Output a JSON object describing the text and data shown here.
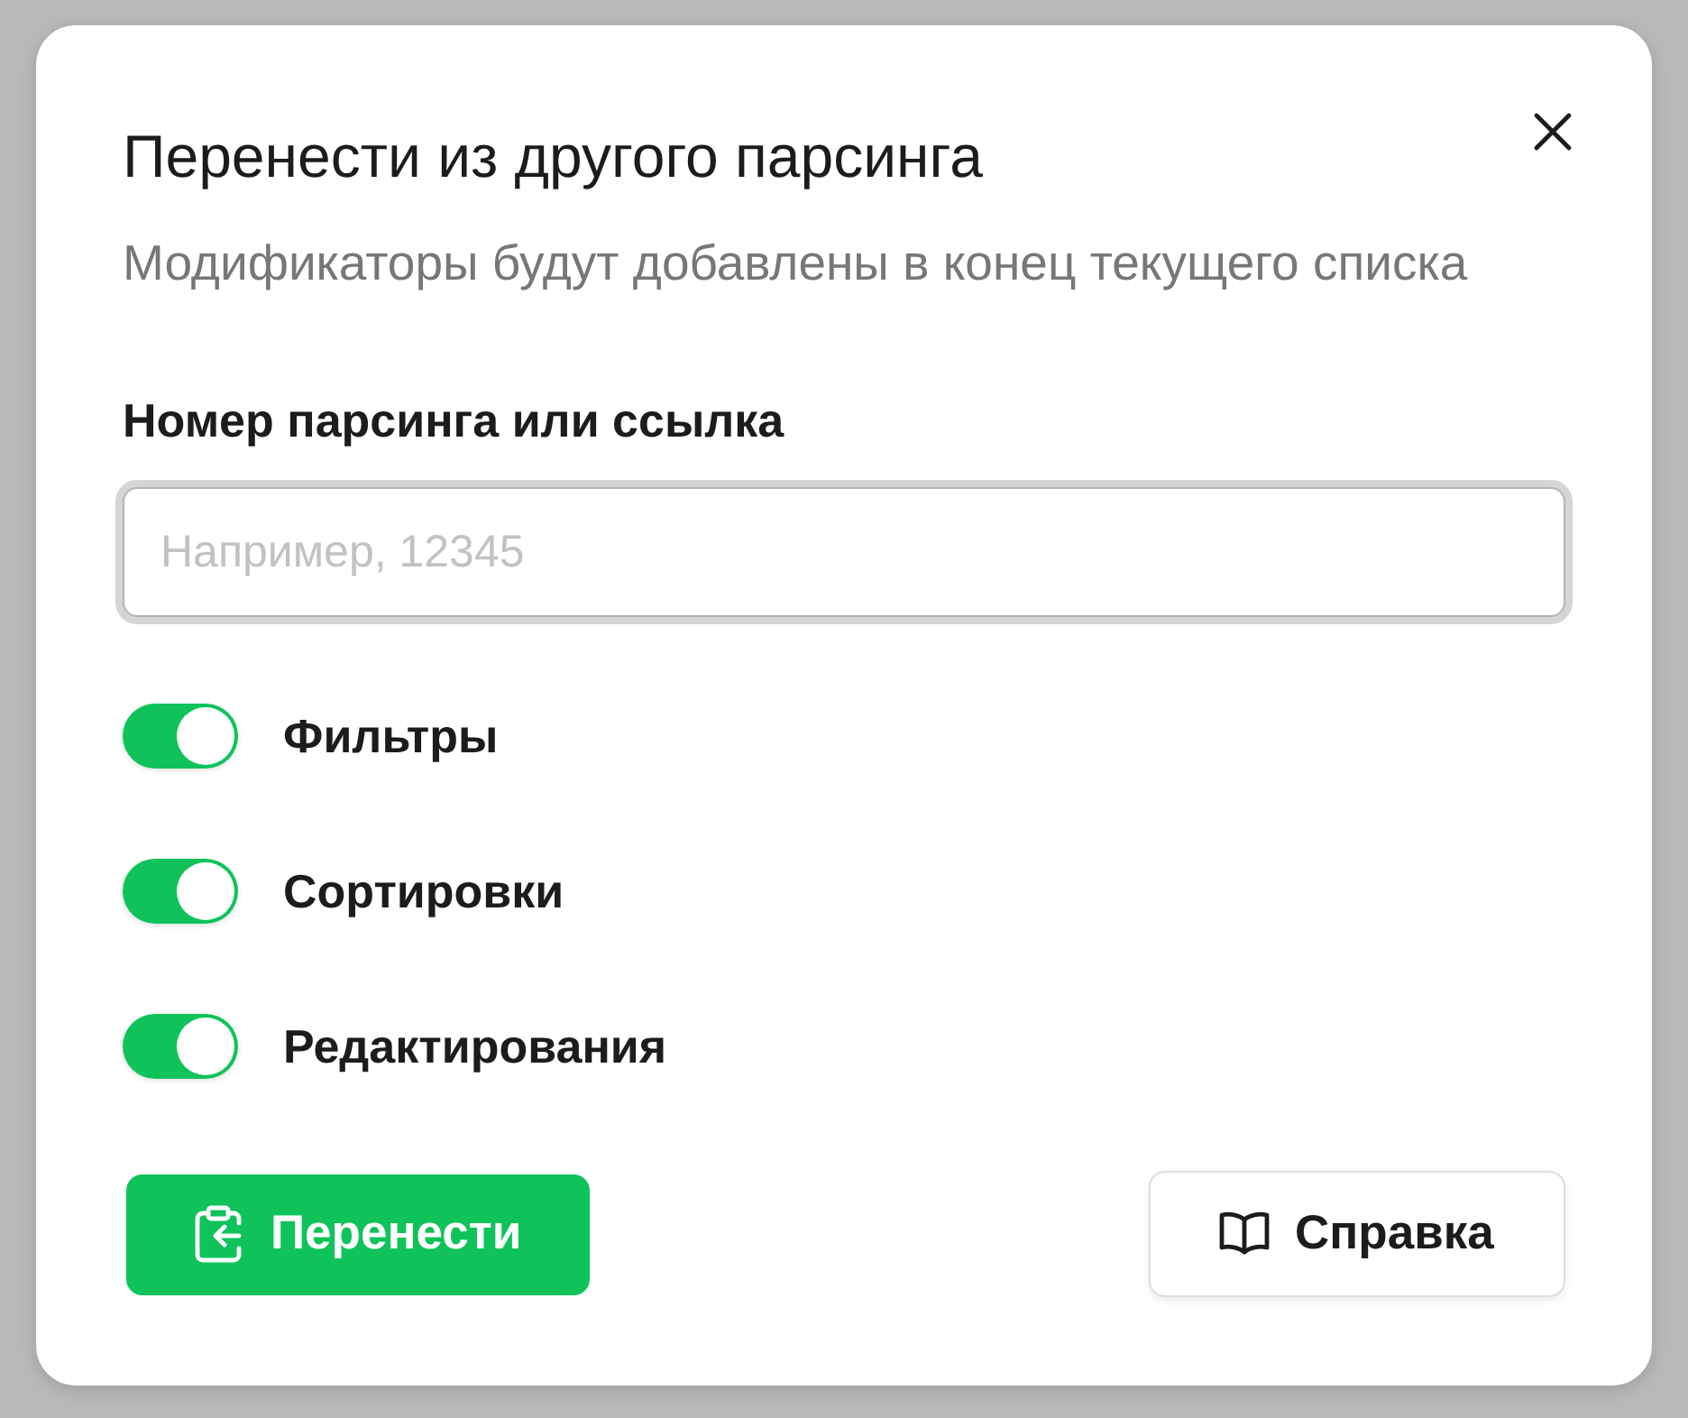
{
  "dialog": {
    "title": "Перенести из другого парсинга",
    "subtitle": "Модификаторы будут добавлены в конец текущего списка"
  },
  "field": {
    "label": "Номер парсинга или ссылка",
    "placeholder": "Например, 12345"
  },
  "toggles": [
    {
      "label": "Фильтры",
      "on": true
    },
    {
      "label": "Сортировки",
      "on": true
    },
    {
      "label": "Редактирования",
      "on": true
    }
  ],
  "buttons": [
    {
      "kind": "primary",
      "label": "Перенести"
    },
    {
      "kind": "secondary",
      "label": "Справка"
    }
  ]
}
